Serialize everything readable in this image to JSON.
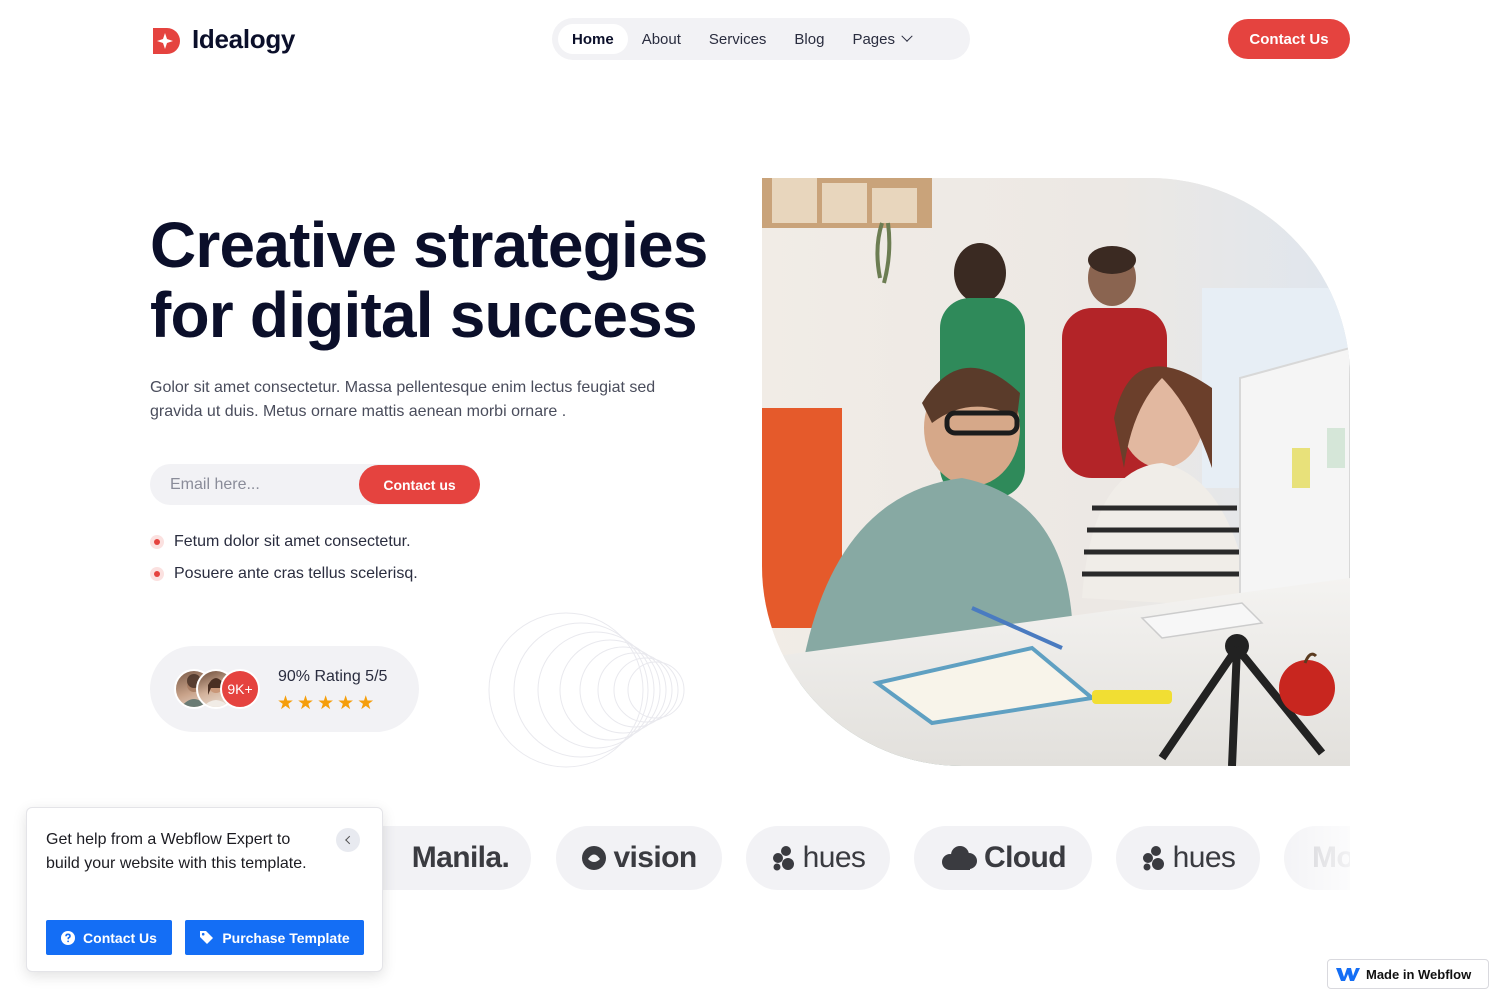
{
  "header": {
    "brand": "Idealogy",
    "nav": [
      {
        "label": "Home",
        "active": true
      },
      {
        "label": "About"
      },
      {
        "label": "Services"
      },
      {
        "label": "Blog"
      },
      {
        "label": "Pages",
        "has_dropdown": true
      }
    ],
    "cta_label": "Contact Us"
  },
  "hero": {
    "title_line1": "Creative strategies",
    "title_line2": "for digital success",
    "description": "Golor sit amet consectetur. Massa pellentesque enim lectus feugiat sed gravida ut duis. Metus ornare mattis aenean morbi ornare .",
    "email_placeholder": "Email here...",
    "email_button": "Contact us",
    "bullets": [
      "Fetum dolor sit amet consectetur.",
      "Posuere ante cras tellus scelerisq."
    ],
    "rating": {
      "count_badge": "9K+",
      "text": "90% Rating 5/5",
      "stars": 5
    }
  },
  "partner_logos": [
    "Manila.",
    "vision",
    "hues",
    "Cloud",
    "hues",
    "Mo"
  ],
  "help_popup": {
    "text": "Get help from a Webflow Expert to build your website with this template.",
    "contact_label": "Contact Us",
    "purchase_label": "Purchase Template"
  },
  "badge": {
    "label": "Made in Webflow"
  },
  "colors": {
    "accent": "#e5433f",
    "dark": "#0b0f2a",
    "webflow_blue": "#146ef5",
    "star": "#f59e0b"
  }
}
